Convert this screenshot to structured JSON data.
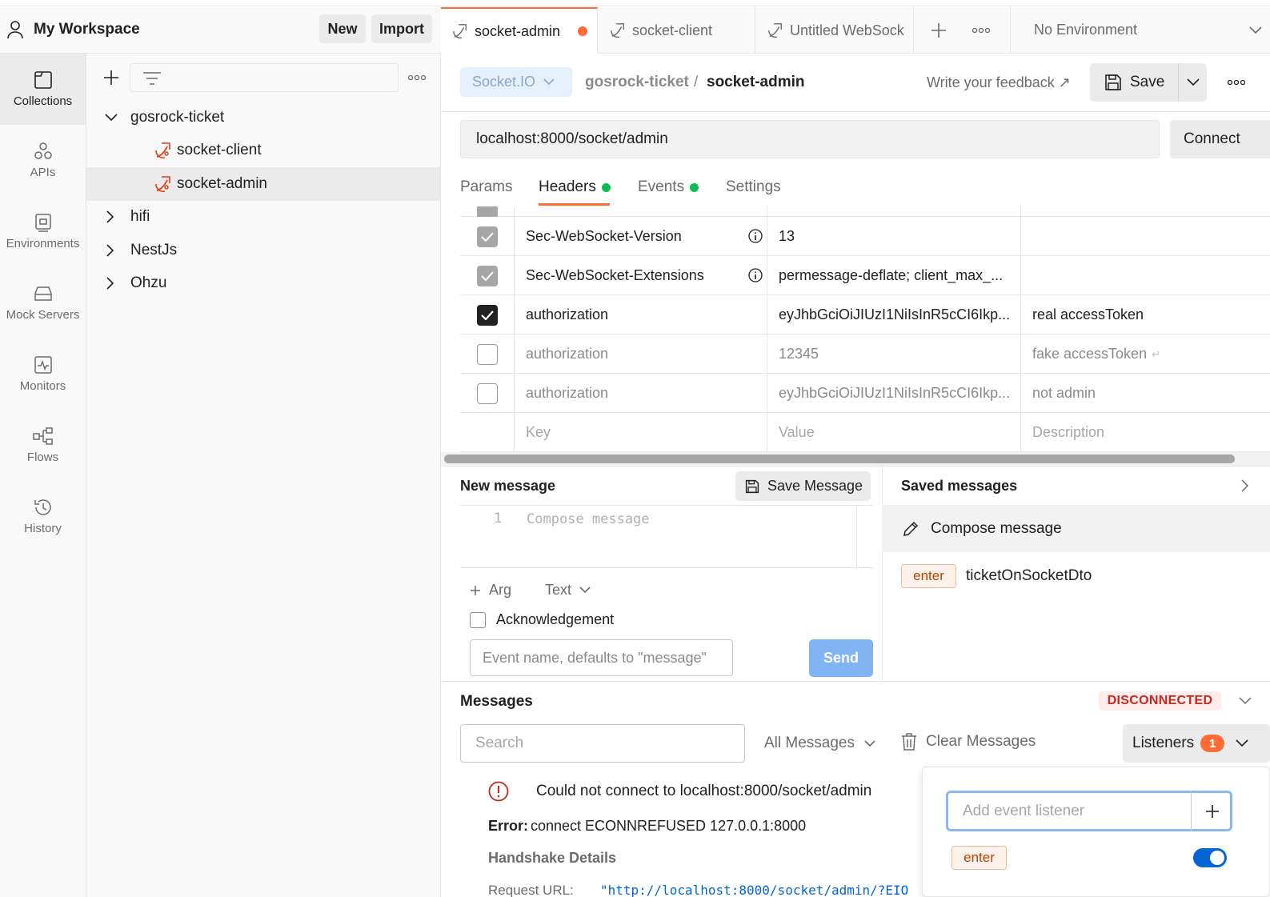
{
  "workspace": {
    "title": "My Workspace",
    "new_label": "New",
    "import_label": "Import"
  },
  "rail": [
    {
      "label": "Collections"
    },
    {
      "label": "APIs"
    },
    {
      "label": "Environments"
    },
    {
      "label": "Mock Servers"
    },
    {
      "label": "Monitors"
    },
    {
      "label": "Flows"
    },
    {
      "label": "History"
    }
  ],
  "tree": {
    "collections": [
      {
        "name": "gosrock-ticket",
        "expanded": true,
        "children": [
          "socket-client",
          "socket-admin"
        ]
      },
      {
        "name": "hifi"
      },
      {
        "name": "NestJs"
      },
      {
        "name": "Ohzu"
      }
    ]
  },
  "tabs": [
    {
      "label": "socket-admin",
      "unsaved": true
    },
    {
      "label": "socket-client"
    },
    {
      "label": "Untitled WebSock"
    }
  ],
  "environment": "No Environment",
  "request": {
    "protocol": "Socket.IO",
    "collection": "gosrock-ticket",
    "separator": "/",
    "name": "socket-admin",
    "feedback": "Write your feedback ↗",
    "save_label": "Save",
    "url": "localhost:8000/socket/admin",
    "connect_label": "Connect",
    "subtabs": [
      "Params",
      "Headers",
      "Events",
      "Settings"
    ]
  },
  "headers": [
    {
      "key": "Sec-WebSocket-Version",
      "value": "13",
      "description": "",
      "state": "gray"
    },
    {
      "key": "Sec-WebSocket-Extensions",
      "value": "permessage-deflate; client_max_...",
      "description": "",
      "state": "gray"
    },
    {
      "key": "authorization",
      "value": "eyJhbGciOiJIUzI1NiIsInR5cCI6Ikp...",
      "description": "real accessToken",
      "state": "checked"
    },
    {
      "key": "authorization",
      "value": "12345",
      "description": "fake accessToken",
      "state": "off"
    },
    {
      "key": "authorization",
      "value": "eyJhbGciOiJIUzI1NiIsInR5cCI6Ikp...",
      "description": "not admin",
      "state": "off"
    }
  ],
  "headers_placeholder": {
    "key": "Key",
    "value": "Value",
    "description": "Description"
  },
  "new_message": {
    "title": "New message",
    "save_label": "Save Message",
    "line_number": "1",
    "placeholder": "Compose message",
    "arg_label": "Arg",
    "format": "Text",
    "ack_label": "Acknowledgement",
    "event_placeholder": "Event name, defaults to \"message\"",
    "send_label": "Send"
  },
  "saved_messages": {
    "title": "Saved messages",
    "compose": "Compose message",
    "items": [
      {
        "tag": "enter",
        "name": "ticketOnSocketDto"
      }
    ]
  },
  "messages": {
    "title": "Messages",
    "status": "DISCONNECTED",
    "search_placeholder": "Search",
    "filter": "All Messages",
    "clear_label": "Clear Messages",
    "listeners_label": "Listeners",
    "listeners_count": "1",
    "error_line": "Could not connect to localhost:8000/socket/admin",
    "error_label": "Error:",
    "error_detail": "connect ECONNREFUSED 127.0.0.1:8000",
    "handshake": "Handshake Details",
    "request_url_label": "Request URL:",
    "request_url_value": "\"http://localhost:8000/socket/admin/?EIO"
  },
  "listener_popover": {
    "placeholder": "Add event listener",
    "items": [
      {
        "name": "enter",
        "enabled": true
      }
    ]
  },
  "colors": {
    "accent": "#ff6c37",
    "primary": "#0265d2",
    "success": "#0cbb52",
    "error": "#c42a1c"
  }
}
